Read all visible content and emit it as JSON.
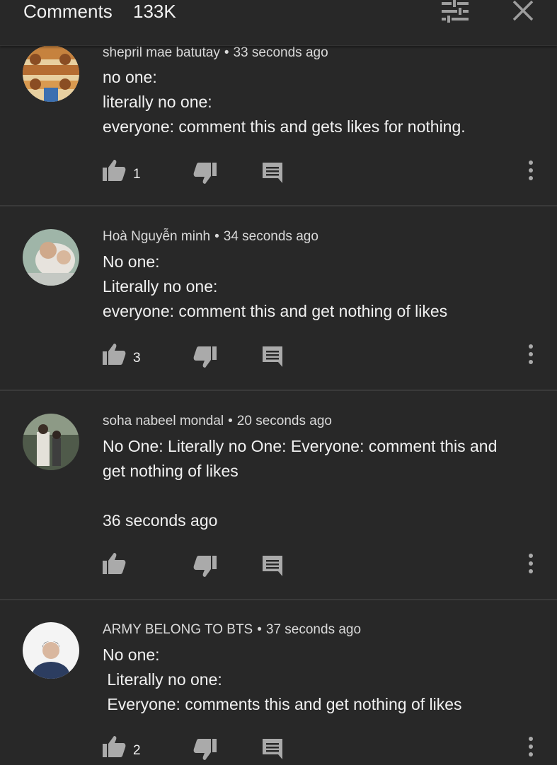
{
  "header": {
    "title": "Comments",
    "count": "133K",
    "filter_icon": "sort-filter-icon",
    "close_icon": "close-icon"
  },
  "comments": [
    {
      "author": "shepril mae batutay",
      "time": "33 seconds ago",
      "text": "no one:\nliterally no one:\neveryone: comment this and gets likes for nothing.",
      "likes": "1",
      "avatar_colors": [
        "#c07a3c",
        "#e9d3a4"
      ]
    },
    {
      "author": "Hoà Nguyễn minh",
      "time": "34 seconds ago",
      "text": "No one:\nLiterally no one:\neveryone: comment this and get nothing of likes",
      "likes": "3",
      "avatar_colors": [
        "#8fa79c",
        "#e5e1dc"
      ]
    },
    {
      "author": "soha nabeel mondal",
      "time": "20 seconds ago",
      "text": "No One: Literally no One: Everyone: comment this and\nget nothing of likes\n\n36 seconds ago",
      "likes": "",
      "avatar_colors": [
        "#556151",
        "#d9d7cf"
      ]
    },
    {
      "author": "ARMY BELONG TO BTS",
      "time": "37 seconds ago",
      "text": "No one:\n Literally no one:\n Everyone: comments this and get nothing of likes",
      "likes": "2",
      "avatar_colors": [
        "#f3f3f3",
        "#2d3f63"
      ]
    }
  ],
  "icons": {
    "like": "thumbs-up-icon",
    "dislike": "thumbs-down-icon",
    "reply": "reply-icon",
    "more": "more-vert-icon"
  },
  "colors": {
    "background": "#282828",
    "text": "#f1f1f1",
    "icon": "#aaaaaa",
    "divider": "#3a3a3a"
  }
}
